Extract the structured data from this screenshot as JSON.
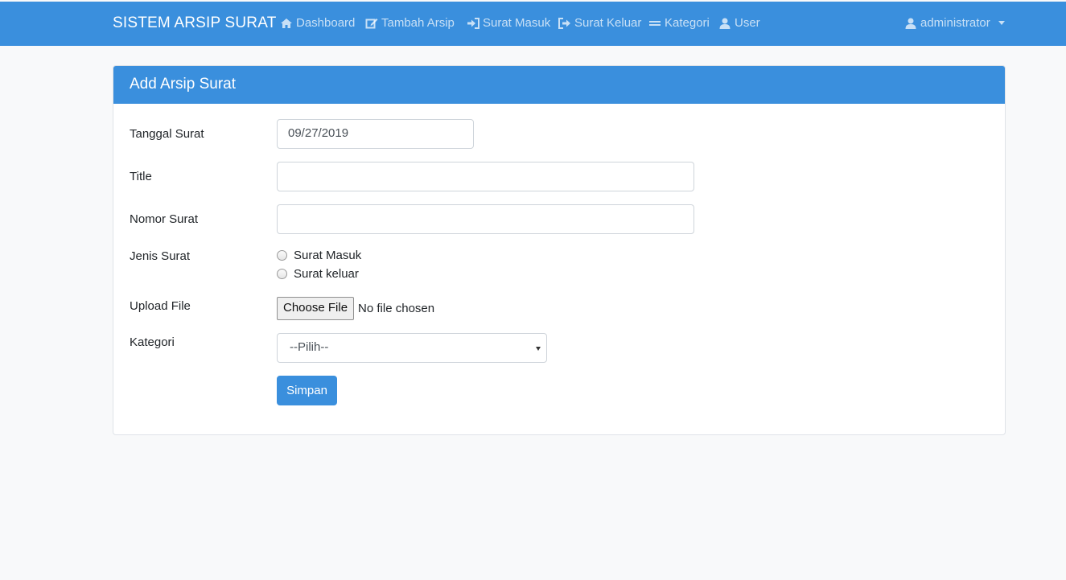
{
  "navbar": {
    "brand": "SISTEM ARSIP SURAT",
    "items": [
      {
        "label": "Dashboard",
        "icon": "home-icon"
      },
      {
        "label": "Tambah Arsip",
        "icon": "edit-icon"
      },
      {
        "label": "Surat Masuk",
        "icon": "sign-in-icon"
      },
      {
        "label": "Surat Keluar",
        "icon": "sign-out-icon"
      },
      {
        "label": "Kategori",
        "icon": "bars-icon"
      },
      {
        "label": "User",
        "icon": "user-icon"
      }
    ],
    "user_menu": {
      "label": "administrator",
      "icon": "user-icon"
    }
  },
  "card": {
    "title": "Add Arsip Surat",
    "fields": {
      "tanggal_label": "Tanggal Surat",
      "tanggal_value": "09/27/2019",
      "title_label": "Title",
      "title_value": "",
      "nomor_label": "Nomor Surat",
      "nomor_value": "",
      "jenis_label": "Jenis Surat",
      "jenis_options": [
        "Surat Masuk",
        "Surat keluar"
      ],
      "upload_label": "Upload File",
      "upload_button": "Choose File",
      "upload_status": "No file chosen",
      "kategori_label": "Kategori",
      "kategori_selected": "--Pilih--"
    },
    "submit_label": "Simpan"
  },
  "colors": {
    "primary": "#3a8fdd",
    "background": "#f8f9fa"
  }
}
